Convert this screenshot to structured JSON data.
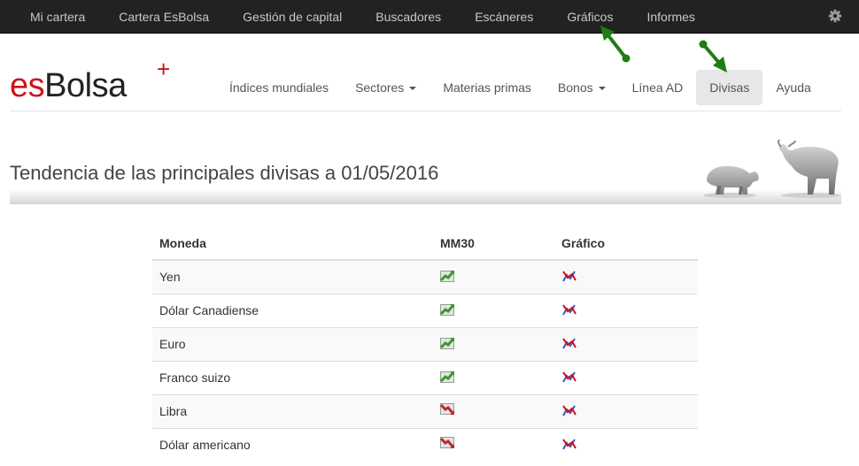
{
  "topbar": {
    "items": [
      "Mi cartera",
      "Cartera EsBolsa",
      "Gestión de capital",
      "Buscadores",
      "Escáneres",
      "Gráficos",
      "Informes"
    ],
    "settings_icon": "gear-icon"
  },
  "logo": {
    "es": "es",
    "bolsa": "Bolsa",
    "plus": "+"
  },
  "mainnav": {
    "indices": "Índices mundiales",
    "sectores": "Sectores",
    "materias": "Materias primas",
    "bonos": "Bonos",
    "linea_ad": "Línea AD",
    "divisas": "Divisas",
    "ayuda": "Ayuda"
  },
  "page": {
    "title": "Tendencia de las principales divisas a 01/05/2016"
  },
  "table": {
    "headers": {
      "moneda": "Moneda",
      "mm30": "MM30",
      "grafico": "Gráfico"
    },
    "rows": [
      {
        "moneda": "Yen",
        "trend": "up",
        "trend_icon": "trend-up-icon",
        "chart_icon": "chart-icon"
      },
      {
        "moneda": "Dólar Canadiense",
        "trend": "up",
        "trend_icon": "trend-up-icon",
        "chart_icon": "chart-icon"
      },
      {
        "moneda": "Euro",
        "trend": "up",
        "trend_icon": "trend-up-icon",
        "chart_icon": "chart-icon"
      },
      {
        "moneda": "Franco suizo",
        "trend": "up",
        "trend_icon": "trend-up-icon",
        "chart_icon": "chart-icon"
      },
      {
        "moneda": "Libra",
        "trend": "down",
        "trend_icon": "trend-down-icon",
        "chart_icon": "chart-icon"
      },
      {
        "moneda": "Dólar americano",
        "trend": "down",
        "trend_icon": "trend-down-icon",
        "chart_icon": "chart-icon"
      }
    ]
  },
  "colors": {
    "topbar_bg": "#222222",
    "brand_red": "#d0121b",
    "active_nav_bg": "#e7e7e7",
    "trend_up": "#3a9a2a",
    "trend_down": "#c0282a",
    "annotation_arrow": "#1e7d14"
  }
}
